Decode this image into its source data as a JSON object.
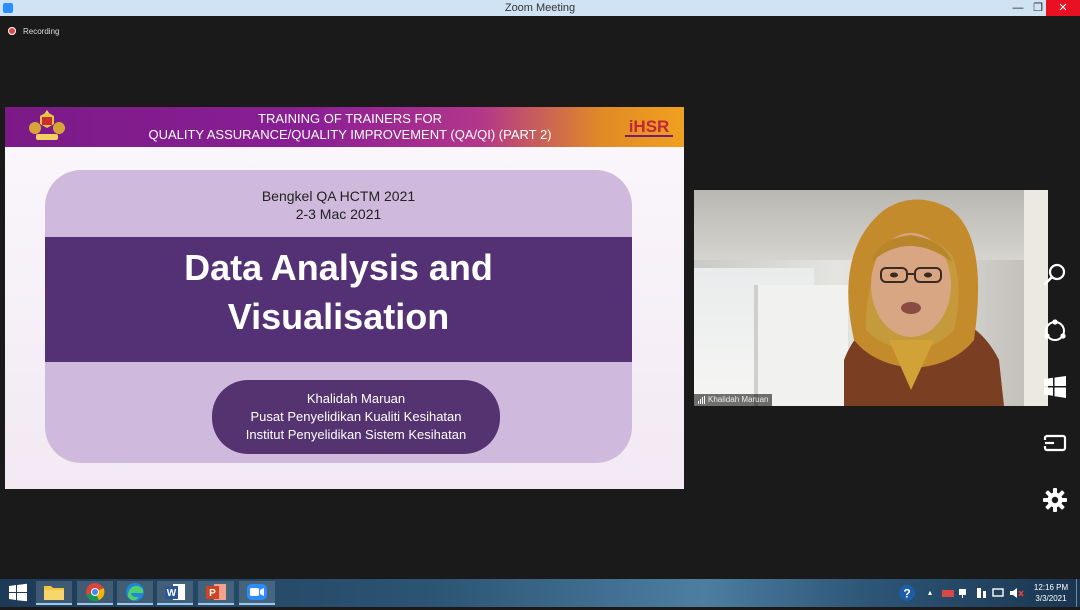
{
  "window": {
    "title": "Zoom Meeting",
    "minimize": "—",
    "maximize": "❐",
    "close": "✕"
  },
  "recording": {
    "label": "Recording"
  },
  "slide": {
    "header_line1": "TRAINING OF TRAINERS FOR",
    "header_line2": "QUALITY ASSURANCE/QUALITY IMPROVEMENT (QA/QI) (PART 2)",
    "logo_text": "iHSR",
    "event_line1": "Bengkel QA HCTM 2021",
    "event_line2": "2-3 Mac 2021",
    "title_line1": "Data Analysis and",
    "title_line2": "Visualisation",
    "presenter_name": "Khalidah Maruan",
    "presenter_affil1": "Pusat Penyelidikan Kualiti Kesihatan",
    "presenter_affil2": "Institut Penyelidikan Sistem Kesihatan"
  },
  "video": {
    "participant_name": "Khalidah Maruan"
  },
  "side_icons": [
    "search-icon",
    "share-icon",
    "start-icon",
    "devices-icon",
    "settings-icon"
  ],
  "taskbar": {
    "apps": [
      "start-icon",
      "file-explorer-icon",
      "chrome-icon",
      "edge-icon",
      "word-icon",
      "powerpoint-icon",
      "zoom-icon"
    ],
    "time": "12:16 PM",
    "date": "3/3/2021"
  },
  "colors": {
    "slide_band": "#533174",
    "slide_card": "#cfb9dc",
    "titlebar": "#cfe3f5",
    "close_button": "#e81123"
  }
}
